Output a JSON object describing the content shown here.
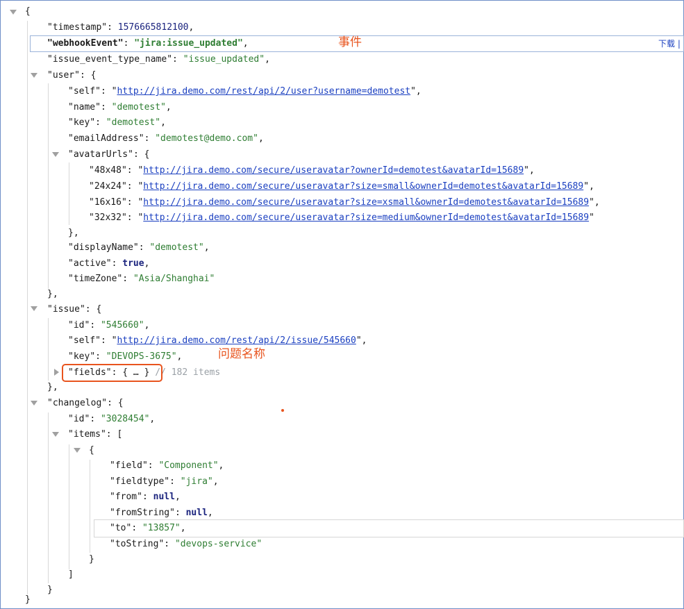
{
  "toolbar": {
    "download_label": "下载"
  },
  "annotations": {
    "event": "事件",
    "issue_name": "问题名称"
  },
  "json": {
    "timestamp": {
      "key": "timestamp",
      "value": "1576665812100"
    },
    "webhookEvent": {
      "key": "webhookEvent",
      "value": "\"jira:issue_updated\""
    },
    "issue_event_type_name": {
      "key": "issue_event_type_name",
      "value": "\"issue_updated\""
    },
    "user": {
      "key": "user",
      "self": {
        "key": "self",
        "value": "http://jira.demo.com/rest/api/2/user?username=demotest"
      },
      "name": {
        "key": "name",
        "value": "\"demotest\""
      },
      "ukey": {
        "key": "key",
        "value": "\"demotest\""
      },
      "emailAddress": {
        "key": "emailAddress",
        "value": "\"demotest@demo.com\""
      },
      "avatarUrls": {
        "key": "avatarUrls",
        "a48": {
          "key": "48x48",
          "value": "http://jira.demo.com/secure/useravatar?ownerId=demotest&avatarId=15689"
        },
        "a24": {
          "key": "24x24",
          "value": "http://jira.demo.com/secure/useravatar?size=small&ownerId=demotest&avatarId=15689"
        },
        "a16": {
          "key": "16x16",
          "value": "http://jira.demo.com/secure/useravatar?size=xsmall&ownerId=demotest&avatarId=15689"
        },
        "a32": {
          "key": "32x32",
          "value": "http://jira.demo.com/secure/useravatar?size=medium&ownerId=demotest&avatarId=15689"
        }
      },
      "displayName": {
        "key": "displayName",
        "value": "\"demotest\""
      },
      "active": {
        "key": "active",
        "value": "true"
      },
      "timeZone": {
        "key": "timeZone",
        "value": "\"Asia/Shanghai\""
      }
    },
    "issue": {
      "key": "issue",
      "id": {
        "key": "id",
        "value": "\"545660\""
      },
      "self": {
        "key": "self",
        "value": "http://jira.demo.com/rest/api/2/issue/545660"
      },
      "ikey": {
        "key": "key",
        "value": "\"DEVOPS-3675\""
      },
      "fields": {
        "key": "fields",
        "collapsed": "{ … }",
        "comment": "// 182 items"
      }
    },
    "changelog": {
      "key": "changelog",
      "id": {
        "key": "id",
        "value": "\"3028454\""
      },
      "items": {
        "key": "items",
        "field": {
          "key": "field",
          "value": "\"Component\""
        },
        "fieldtype": {
          "key": "fieldtype",
          "value": "\"jira\""
        },
        "from": {
          "key": "from",
          "value": "null"
        },
        "fromString": {
          "key": "fromString",
          "value": "null"
        },
        "to": {
          "key": "to",
          "value": "\"13857\""
        },
        "toString": {
          "key": "toString",
          "value": "\"devops-service\""
        }
      }
    }
  }
}
